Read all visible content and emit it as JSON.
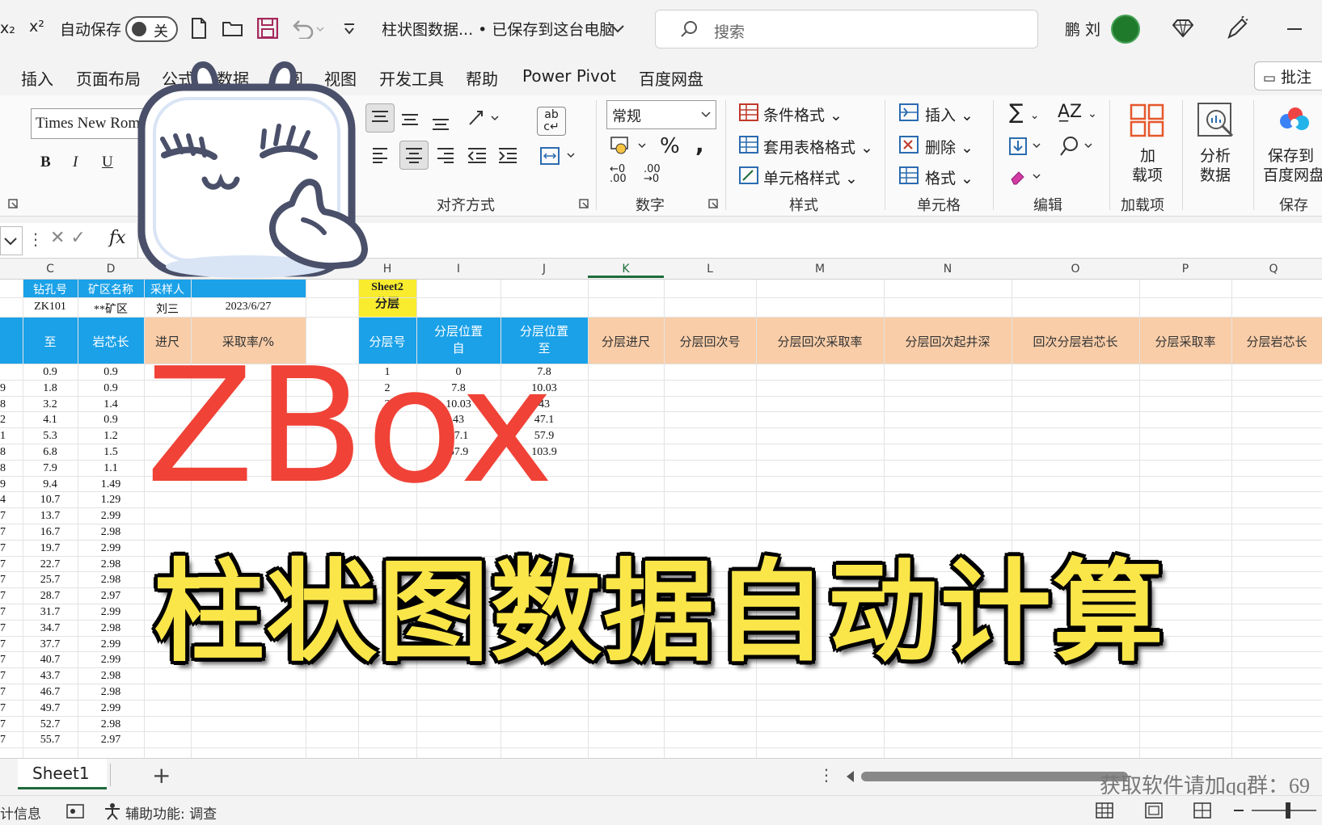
{
  "titlebar": {
    "subscript_label": "x₂",
    "superscript_label": "x²",
    "autosave_label": "自动保存",
    "autosave_state": "关",
    "doc_title": "柱状图数据... • 已保存到这台电脑",
    "search_placeholder": "搜索",
    "user_name": "鹏 刘"
  },
  "menu": {
    "items": [
      "插入",
      "页面布局",
      "公式",
      "数据",
      "审阅",
      "视图",
      "开发工具",
      "帮助",
      "Power Pivot",
      "百度网盘"
    ],
    "comment_label": "批注"
  },
  "ribbon": {
    "font_name": "Times New Roman",
    "bold": "B",
    "italic": "I",
    "underline": "U",
    "number_format": "常规",
    "cond_format": "条件格式",
    "table_format": "套用表格格式",
    "cell_style": "单元格样式",
    "insert": "插入",
    "delete": "删除",
    "format": "格式",
    "addins_line1": "加",
    "addins_line2": "载项",
    "analyze_line1": "分析",
    "analyze_line2": "数据",
    "save_baidu_line1": "保存到",
    "save_baidu_line2": "百度网盘",
    "groups": {
      "align": "对齐方式",
      "number": "数字",
      "styles": "样式",
      "cells": "单元格",
      "editing": "编辑",
      "addins": "加载项",
      "save": "保存"
    }
  },
  "formula_bar": {
    "fx": "fx"
  },
  "columns": [
    "C",
    "D",
    "H",
    "I",
    "J",
    "K",
    "L",
    "M",
    "N",
    "O",
    "P",
    "Q"
  ],
  "left_table": {
    "header_row1": [
      "钻孔号",
      "矿区名称",
      "采样人"
    ],
    "row2": [
      "ZK101",
      "**矿区",
      "刘三",
      "2023/6/27"
    ],
    "headers": [
      "至",
      "岩芯长",
      "进尺",
      "采取率/%"
    ],
    "rows": [
      [
        "0.9",
        "0.9"
      ],
      [
        "1.8",
        "0.9"
      ],
      [
        "3.2",
        "1.4"
      ],
      [
        "4.1",
        "0.9"
      ],
      [
        "5.3",
        "1.2"
      ],
      [
        "6.8",
        "1.5"
      ],
      [
        "7.9",
        "1.1"
      ],
      [
        "9.4",
        "1.49"
      ],
      [
        "10.7",
        "1.29"
      ],
      [
        "13.7",
        "2.99"
      ],
      [
        "16.7",
        "2.98"
      ],
      [
        "19.7",
        "2.99"
      ],
      [
        "22.7",
        "2.98"
      ],
      [
        "25.7",
        "2.98"
      ],
      [
        "28.7",
        "2.97"
      ],
      [
        "31.7",
        "2.99"
      ],
      [
        "34.7",
        "2.98"
      ],
      [
        "37.7",
        "2.99"
      ],
      [
        "40.7",
        "2.99"
      ],
      [
        "43.7",
        "2.98"
      ],
      [
        "46.7",
        "2.98"
      ],
      [
        "49.7",
        "2.99"
      ],
      [
        "52.7",
        "2.98"
      ],
      [
        "55.7",
        "2.97"
      ]
    ],
    "left_edge_digits": [
      "",
      "9",
      "8",
      "2",
      "1",
      "8",
      "8",
      "9",
      "4",
      "7",
      "7",
      "7",
      "7",
      "7",
      "7",
      "7",
      "7",
      "7",
      "7",
      "7",
      "7",
      "7",
      "7",
      "7"
    ]
  },
  "layer_table": {
    "sheet_ref_line1": "Sheet2",
    "sheet_ref_line2": "分层",
    "headers": [
      "分层号",
      "分层位置\n自",
      "分层位置\n至"
    ],
    "rows": [
      [
        "1",
        "0",
        "7.8"
      ],
      [
        "2",
        "7.8",
        "10.03"
      ],
      [
        "3",
        "10.03",
        "43"
      ],
      [
        "4",
        "43",
        "47.1"
      ],
      [
        "5",
        "47.1",
        "57.9"
      ],
      [
        "6",
        "57.9",
        "103.9"
      ]
    ],
    "peach_headers": [
      "分层进尺",
      "分层回次号",
      "分层回次采取率",
      "分层回次起井深",
      "回次分层岩芯长",
      "分层采取率",
      "分层岩芯长"
    ]
  },
  "overlay": {
    "brand": "ZBox",
    "title": "柱状图数据自动计算",
    "watermark": "获取软件请加qq群：69"
  },
  "tabs": {
    "sheet1": "Sheet1",
    "add": "+"
  },
  "status": {
    "info": "计信息",
    "accessibility": "辅助功能: 调查"
  },
  "colors": {
    "excel_green": "#1e6b3a",
    "header_blue": "#1aa1e8",
    "header_peach": "#f9cda8",
    "brand_red": "#f04237",
    "title_yellow": "#fbe64a"
  }
}
